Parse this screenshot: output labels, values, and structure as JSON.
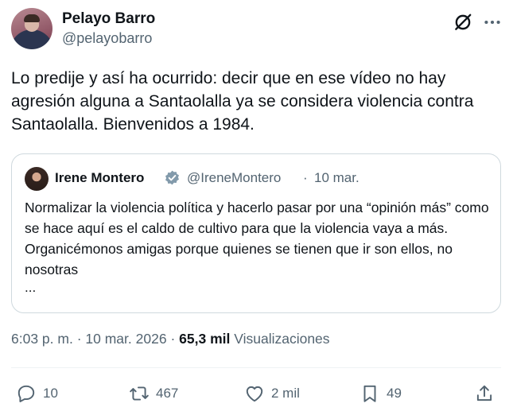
{
  "author": {
    "name": "Pelayo Barro",
    "handle": "@pelayobarro"
  },
  "tweet": {
    "text": "Lo predije y así ha ocurrido: decir que en ese vídeo no hay agresión alguna a Santaolalla ya se considera violencia contra Santaolalla. Bienvenidos a 1984."
  },
  "quote": {
    "name": "Irene Montero",
    "handle": "@IreneMontero",
    "separator": "·",
    "date": "10 mar.",
    "text": "Normalizar la violencia política y hacerlo pasar por una “opinión más” como se hace aquí es el caldo de cultivo para que la violencia vaya a más. Organicémonos amigas porque quienes se tienen que ir son ellos, no nosotras",
    "ellipsis": "..."
  },
  "meta": {
    "time": "6:03 p. m.",
    "sep1": "·",
    "date": "10 mar. 2026",
    "sep2": "·",
    "views_count": "65,3 mil",
    "views_label": "Visualizaciones"
  },
  "actions": {
    "replies": "10",
    "reposts": "467",
    "likes": "2 mil",
    "bookmarks": "49"
  },
  "icons": [
    "grok-icon",
    "more-icon",
    "verified-icon",
    "reply-icon",
    "retweet-icon",
    "like-icon",
    "bookmark-icon",
    "share-icon"
  ],
  "colors": {
    "text": "#0f1419",
    "secondary": "#536471",
    "border": "#cfd9de",
    "verified": "#829aab"
  }
}
